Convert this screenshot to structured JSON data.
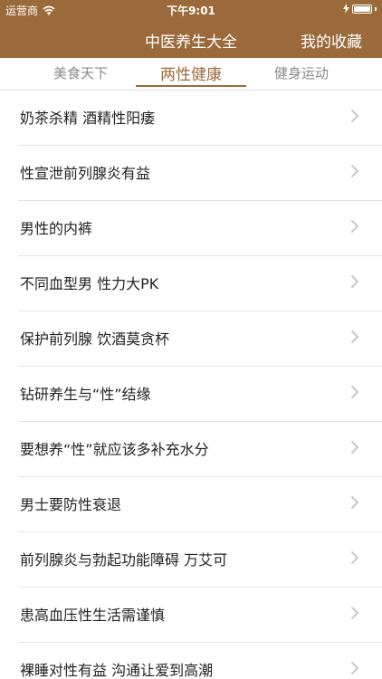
{
  "status_bar": {
    "carrier": "运营商",
    "time": "下午9:01",
    "battery_level": 1.0
  },
  "nav": {
    "title": "中医养生大全",
    "right_button": "我的收藏"
  },
  "tabs": [
    {
      "label": "美食天下",
      "active": false
    },
    {
      "label": "两性健康",
      "active": true
    },
    {
      "label": "健身运动",
      "active": false
    }
  ],
  "list": [
    {
      "label": "奶茶杀精 酒精性阳痿"
    },
    {
      "label": "性宣泄前列腺炎有益"
    },
    {
      "label": "男性的内裤"
    },
    {
      "label": "不同血型男 性力大PK"
    },
    {
      "label": "保护前列腺 饮酒莫贪杯"
    },
    {
      "label": "钻研养生与“性”结缘"
    },
    {
      "label": "要想养“性”就应该多补充水分"
    },
    {
      "label": "男士要防性衰退"
    },
    {
      "label": "前列腺炎与勃起功能障碍 万艾可"
    },
    {
      "label": "患高血压性生活需谨慎"
    },
    {
      "label": "裸睡对性有益 沟通让爱到高潮"
    }
  ],
  "colors": {
    "accent": "#9b6a3a",
    "separator": "#e3e3e3",
    "text": "#222222",
    "tab_inactive": "#8a8a8a"
  },
  "icons": {
    "wifi": "wifi-icon",
    "battery": "battery-icon",
    "chevron": "chevron-right-icon"
  }
}
